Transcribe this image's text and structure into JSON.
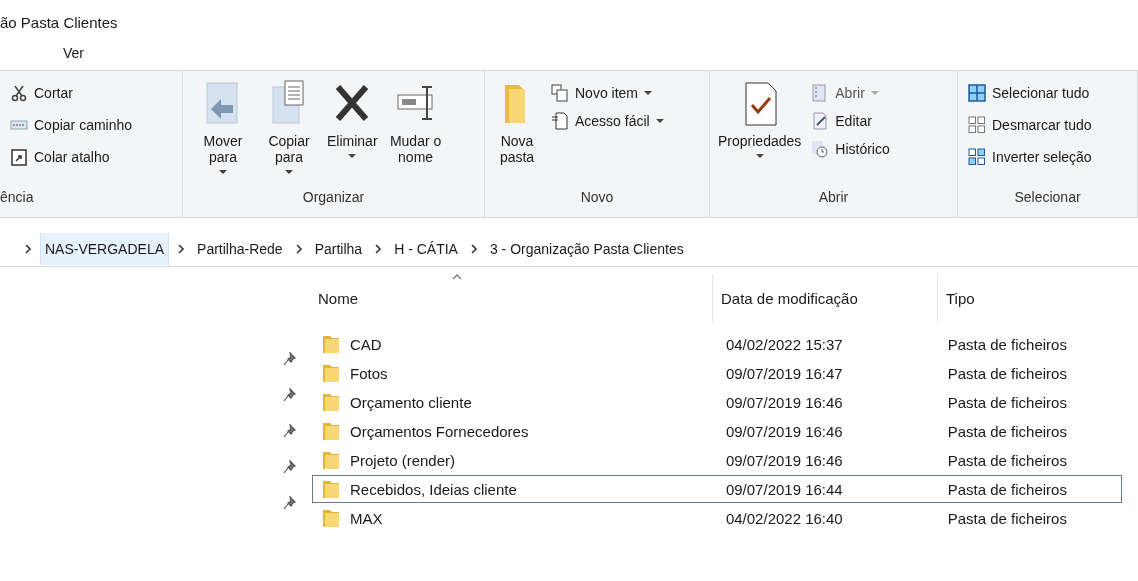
{
  "window": {
    "title": "ão Pasta Clientes"
  },
  "ribbon_tabs": [
    {
      "label": "Ver",
      "selected": false
    }
  ],
  "ribbon_groups": [
    {
      "kind": "list",
      "label": "ência",
      "items": [
        {
          "label": "Cortar"
        },
        {
          "label": "Copiar caminho"
        },
        {
          "label": "Colar atalho"
        }
      ]
    },
    {
      "kind": "large",
      "label": "Organizar",
      "items": [
        {
          "label": "Mover para",
          "dropdown": true
        },
        {
          "label": "Copiar para",
          "dropdown": true
        },
        {
          "label": "Eliminar",
          "dropdown": true
        },
        {
          "label": "Mudar o nome",
          "dropdown": false
        }
      ]
    },
    {
      "kind": "mixed",
      "label": "Novo",
      "items": [
        {
          "label": "Nova pasta",
          "dropdown": false,
          "kind": "large"
        },
        {
          "label": "Novo item",
          "dropdown": true,
          "kind": "small"
        },
        {
          "label": "Acesso fácil",
          "dropdown": true,
          "kind": "small"
        }
      ]
    },
    {
      "kind": "mixed",
      "label": "Abrir",
      "items": [
        {
          "label": "Propriedades",
          "dropdown": true,
          "kind": "large"
        },
        {
          "label": "Abrir",
          "dropdown": true,
          "kind": "small",
          "disabled": true
        },
        {
          "label": "Editar",
          "dropdown": false,
          "kind": "small",
          "disabled": false
        },
        {
          "label": "Histórico",
          "dropdown": false,
          "kind": "small",
          "disabled": false
        }
      ]
    },
    {
      "kind": "list",
      "label": "Selecionar",
      "items": [
        {
          "label": "Selecionar tudo"
        },
        {
          "label": "Desmarcar tudo"
        },
        {
          "label": "Inverter seleção"
        }
      ]
    }
  ],
  "breadcrumb": [
    {
      "label": "NAS-VERGADELA",
      "selected": true
    },
    {
      "label": "Partilha-Rede",
      "selected": false
    },
    {
      "label": "Partilha",
      "selected": false
    },
    {
      "label": "H - CÁTIA",
      "selected": false
    },
    {
      "label": "3 - Organização Pasta Clientes",
      "selected": false
    }
  ],
  "table": {
    "columns": [
      {
        "label": "Nome",
        "sorted": true
      },
      {
        "label": "Data de modificação",
        "sorted": false
      },
      {
        "label": "Tipo",
        "sorted": false
      }
    ],
    "rows": [
      {
        "name": "CAD",
        "date": "04/02/2022 15:37",
        "type": "Pasta de ficheiros",
        "focused": false
      },
      {
        "name": "Fotos",
        "date": "09/07/2019 16:47",
        "type": "Pasta de ficheiros",
        "focused": false
      },
      {
        "name": "Orçamento cliente",
        "date": "09/07/2019 16:46",
        "type": "Pasta de ficheiros",
        "focused": false
      },
      {
        "name": "Orçamentos Fornecedores",
        "date": "09/07/2019 16:46",
        "type": "Pasta de ficheiros",
        "focused": false
      },
      {
        "name": "Projeto (render)",
        "date": "09/07/2019 16:46",
        "type": "Pasta de ficheiros",
        "focused": false
      },
      {
        "name": "Recebidos, Ideias cliente",
        "date": "09/07/2019 16:44",
        "type": "Pasta de ficheiros",
        "focused": true
      },
      {
        "name": "MAX",
        "date": "04/02/2022 16:40",
        "type": "Pasta de ficheiros",
        "focused": false
      }
    ]
  }
}
